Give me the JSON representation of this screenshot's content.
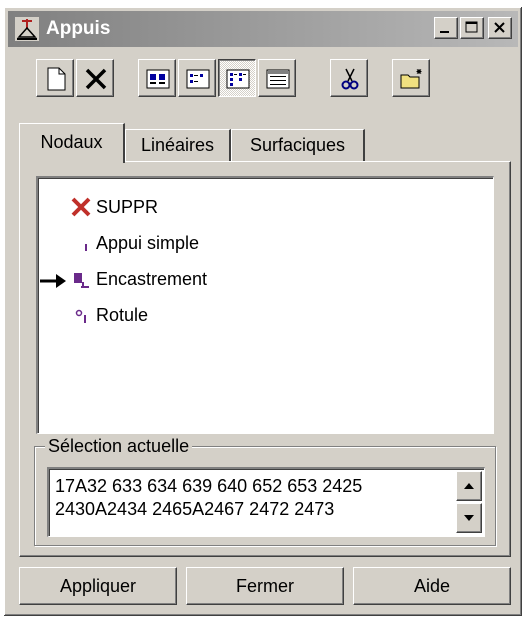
{
  "window": {
    "title": "Appuis",
    "title_buttons": [
      "minimize",
      "maximize",
      "close"
    ]
  },
  "toolbar": {
    "buttons": [
      {
        "name": "new-icon",
        "pressed": false
      },
      {
        "name": "delete-x-icon",
        "pressed": false
      },
      {
        "name": "large-icons-view-icon",
        "pressed": false
      },
      {
        "name": "small-icons-view-icon",
        "pressed": false
      },
      {
        "name": "list-view-icon",
        "pressed": true
      },
      {
        "name": "details-view-icon",
        "pressed": false
      },
      {
        "name": "scissors-icon",
        "pressed": false
      },
      {
        "name": "new-folder-icon",
        "pressed": false
      }
    ]
  },
  "tabs": [
    {
      "label": "Nodaux",
      "active": true
    },
    {
      "label": "Linéaires",
      "active": false
    },
    {
      "label": "Surfaciques",
      "active": false
    }
  ],
  "tree": {
    "items": [
      {
        "label": "SUPPR",
        "icon": "red-x-icon",
        "current": false
      },
      {
        "label": "Appui simple",
        "icon": "simple-support-icon",
        "current": false
      },
      {
        "label": "Encastrement",
        "icon": "fixed-support-icon",
        "current": true
      },
      {
        "label": "Rotule",
        "icon": "hinge-icon",
        "current": false
      }
    ]
  },
  "selection": {
    "label": "Sélection actuelle",
    "value": "17A32 633 634 639 640 652 653 2425\n2430A2434 2465A2467 2472 2473"
  },
  "buttons": {
    "apply": "Appliquer",
    "close": "Fermer",
    "help": "Aide"
  },
  "colors": {
    "face": "#d4d0c8",
    "title_inactive": "#808080",
    "delete_red": "#c0302a",
    "support_purple": "#6a2a8a"
  }
}
